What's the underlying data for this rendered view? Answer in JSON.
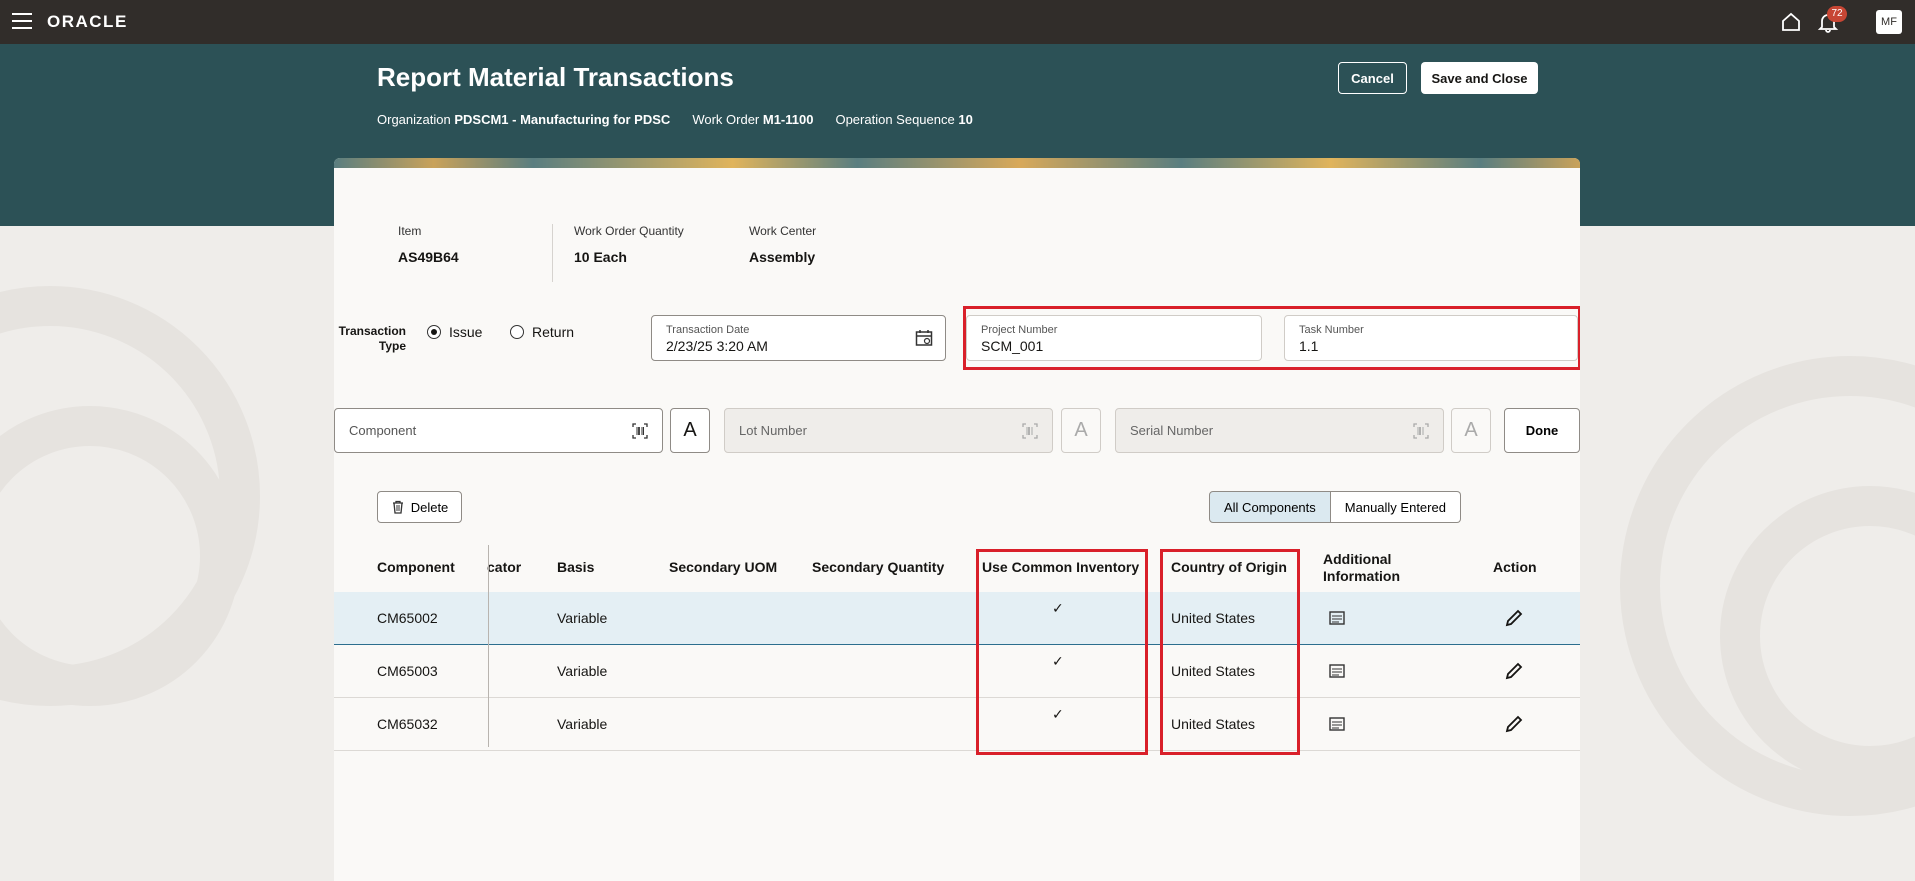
{
  "app": {
    "logo": "ORACLE",
    "notification_count": "72",
    "user_initials": "MF"
  },
  "header": {
    "title": "Report Material Transactions",
    "cancel_label": "Cancel",
    "save_close_label": "Save and Close",
    "org_label": "Organization",
    "org_value": "PDSCM1 - Manufacturing for PDSC",
    "wo_label": "Work Order",
    "wo_value": "M1-1100",
    "opseq_label": "Operation Sequence",
    "opseq_value": "10"
  },
  "summary": {
    "item_label": "Item",
    "item_value": "AS49B64",
    "qty_label": "Work Order Quantity",
    "qty_value": "10 Each",
    "wc_label": "Work Center",
    "wc_value": "Assembly"
  },
  "transaction": {
    "type_label": "Transaction Type",
    "issue_label": "Issue",
    "return_label": "Return",
    "selected": "Issue",
    "date_label": "Transaction Date",
    "date_value": "2/23/25 3:20 AM",
    "project_label": "Project Number",
    "project_value": "SCM_001",
    "task_label": "Task Number",
    "task_value": "1.1"
  },
  "scan": {
    "component_placeholder": "Component",
    "lot_placeholder": "Lot Number",
    "serial_placeholder": "Serial Number",
    "done_label": "Done"
  },
  "toolbar": {
    "delete_label": "Delete",
    "filter_all": "All Components",
    "filter_manual": "Manually Entered"
  },
  "table": {
    "headers": {
      "component": "Component",
      "indicator": "cator",
      "basis": "Basis",
      "sec_uom": "Secondary UOM",
      "sec_qty": "Secondary Quantity",
      "common_inv": "Use Common Inventory",
      "country": "Country of Origin",
      "additional": "Additional Information",
      "action": "Action"
    },
    "rows": [
      {
        "component": "CM65002",
        "basis": "Variable",
        "common_inv": "✓",
        "country": "United States"
      },
      {
        "component": "CM65003",
        "basis": "Variable",
        "common_inv": "✓",
        "country": "United States"
      },
      {
        "component": "CM65032",
        "basis": "Variable",
        "common_inv": "✓",
        "country": "United States"
      }
    ]
  }
}
